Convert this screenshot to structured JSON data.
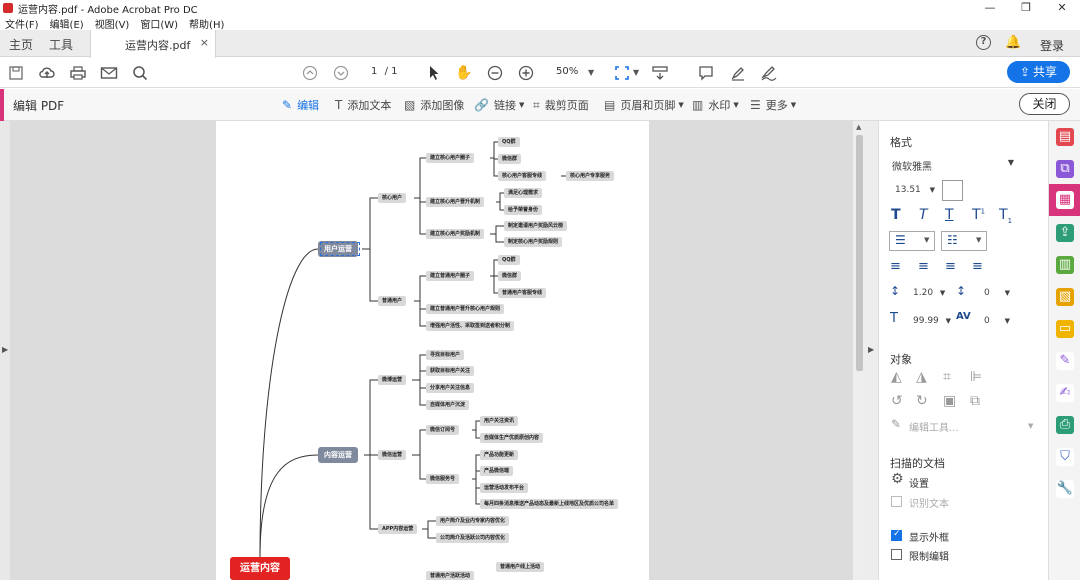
{
  "window": {
    "title": "运营内容.pdf - Adobe Acrobat Pro DC",
    "controls": [
      "—",
      "❐",
      "✕"
    ]
  },
  "menu": [
    "文件(F)",
    "编辑(E)",
    "视图(V)",
    "窗口(W)",
    "帮助(H)"
  ],
  "tabs": {
    "home": "主页",
    "tools": "工具",
    "document": "运营内容.pdf",
    "close": "×",
    "login": "登录"
  },
  "toolbar": {
    "page_current": "1",
    "page_total": "/ 1",
    "zoom": "50%",
    "share": "共享"
  },
  "editbar": {
    "label": "编辑 PDF",
    "tools": [
      "编辑",
      "添加文本",
      "添加图像",
      "链接",
      "裁剪页面",
      "页眉和页脚",
      "水印",
      "更多"
    ],
    "close": "关闭"
  },
  "panel": {
    "format_title": "格式",
    "font": "微软雅黑",
    "font_size": "13.51",
    "line_spacing": "1.20",
    "para_spacing": "0",
    "scale": "99.99",
    "char_spacing": "0",
    "objects_title": "对象",
    "edit_tool": "编辑工具...",
    "scanned_title": "扫描的文档",
    "settings": "设置",
    "recognize": "识别文本",
    "show_box": "显示外框",
    "restrict": "限制编辑"
  },
  "mindmap": {
    "root": "运营内容",
    "l1_user": "用户运营",
    "l1_content": "内容运营",
    "l2_core": "核心用户",
    "l2_normal": "普通用户",
    "l2_weibo": "微博运营",
    "l2_wechat": "微信运营",
    "l2_app": "APP内容运营",
    "core_circle": "建立核心用户圈子",
    "qq1": "QQ群",
    "wx1": "微信群",
    "core_service": "核心用户客服专线",
    "core_exclusive": "核心用户专享服务",
    "core_promote": "建立核心用户晋升机制",
    "need": "满足心理需求",
    "honor": "给予荣誉身份",
    "core_reward": "建立核心用户奖励机制",
    "reward1": "制定邀请用户奖励风云榜",
    "reward2": "制定核心用户奖励规则",
    "normal_circle": "建立普通用户圈子",
    "qq2": "QQ群",
    "wx2": "微信群",
    "normal_service": "普通用户客服专线",
    "normal_rule": "建立普通用户晋升核心用户规则",
    "normal_active": "增强用户活性、采取签到送者积分制",
    "wb1": "寻找目标用户",
    "wb2": "获取目标用户关注",
    "wb3": "分享用户关注信息",
    "wb4": "自媒体用户沉淀",
    "sub": "微信订阅号",
    "sub1": "用户关注资讯",
    "sub2": "自媒体生产优质原创内容",
    "svc": "微信服务号",
    "svc1": "产品功能更新",
    "svc2": "产品微信端",
    "svc3": "运营活动发布平台",
    "svc4": "每月四条消息推送产品动态及最新上线地区及优质公司名单",
    "app1": "用户简介及业内专家内容优化",
    "app2": "公司简介及活跃公司内容优化",
    "bottom1": "普通用户活跃活动",
    "bottom2": "普通用户线上活动"
  }
}
